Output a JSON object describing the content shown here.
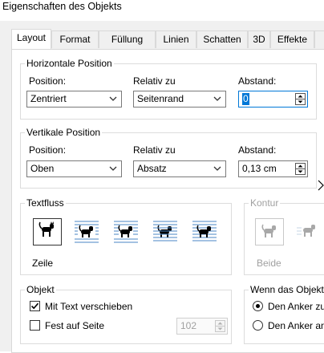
{
  "window": {
    "title": "Eigenschaften des Objekts"
  },
  "tabs": [
    {
      "label": "Layout",
      "active": true
    },
    {
      "label": "Format"
    },
    {
      "label": "Füllung"
    },
    {
      "label": "Linien"
    },
    {
      "label": "Schatten"
    },
    {
      "label": "3D"
    },
    {
      "label": "Effekte"
    }
  ],
  "horizontal": {
    "title": "Horizontale Position",
    "position_label": "Position:",
    "position_value": "Zentriert",
    "relative_label": "Relativ zu",
    "relative_value": "Seitenrand",
    "distance_label": "Abstand:",
    "distance_value": "0"
  },
  "vertical": {
    "title": "Vertikale Position",
    "position_label": "Position:",
    "position_value": "Oben",
    "relative_label": "Relativ zu",
    "relative_value": "Absatz",
    "distance_label": "Abstand:",
    "distance_value": "0,13 cm"
  },
  "textflow": {
    "title": "Textfluss",
    "selected_label": "Zeile",
    "options": [
      "inline-wrap-icon",
      "square-wrap-icon",
      "tight-wrap-icon",
      "through-wrap-icon",
      "top-bottom-wrap-icon"
    ]
  },
  "contour": {
    "title": "Kontur",
    "label": "Beide"
  },
  "object": {
    "title": "Objekt",
    "move_with_text": "Mit Text verschieben",
    "move_with_text_checked": true,
    "fixed_on_page": "Fest auf Seite",
    "fixed_on_page_checked": false,
    "page_value": "102"
  },
  "anchor": {
    "title": "Wenn das Objekt",
    "option1": "Den Anker zu",
    "option2": "Den Anker an",
    "selected": 1
  },
  "colors": {
    "accent": "#0078d7",
    "icon_blue": "#4a86c5"
  }
}
